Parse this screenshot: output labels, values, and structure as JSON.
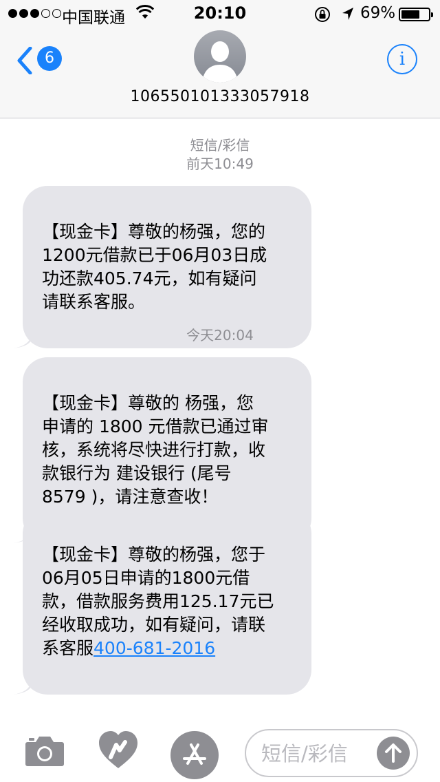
{
  "status_bar": {
    "carrier": "中国联通",
    "time": "20:10",
    "battery_percent": "69%",
    "battery_level": 0.69,
    "signal_bars_filled": 3,
    "signal_bars_total": 5
  },
  "header": {
    "back_badge_count": "6",
    "contact_number": "106550101333057918",
    "icons": {
      "back": "chevron-left-icon",
      "avatar": "person-icon",
      "info": "info-icon"
    }
  },
  "conversation": {
    "header_label": "短信/彩信",
    "timestamp_1": "前天10:49",
    "timestamp_2": "今天20:04",
    "messages": [
      {
        "text": "【现金卡】尊敬的杨强，您的\n1200元借款已于06月03日成\n功还款405.74元，如有疑问\n请联系客服。"
      },
      {
        "text": "【现金卡】尊敬的  杨强，您\n申请的 1800 元借款已通过审\n核，系统将尽快进行打款，收\n款银行为  建设银行 (尾号\n8579 )，请注意查收！"
      },
      {
        "text": "【现金卡】尊敬的杨强，您于\n06月05日申请的1800元借\n款，借款服务费用125.17元已\n经收取成功，如有疑问，请联\n系客服",
        "link": "400-681-2016"
      }
    ]
  },
  "input_bar": {
    "placeholder": "短信/彩信",
    "icons": {
      "camera": "camera-icon",
      "digital_touch": "heart-hands-icon",
      "app_store": "app-store-icon",
      "send": "arrow-up-icon"
    }
  },
  "colors": {
    "accent": "#1a82fb",
    "bubble": "#e5e5ea",
    "timestamp": "#8e8e93",
    "bar_background": "#f7f7f7"
  }
}
